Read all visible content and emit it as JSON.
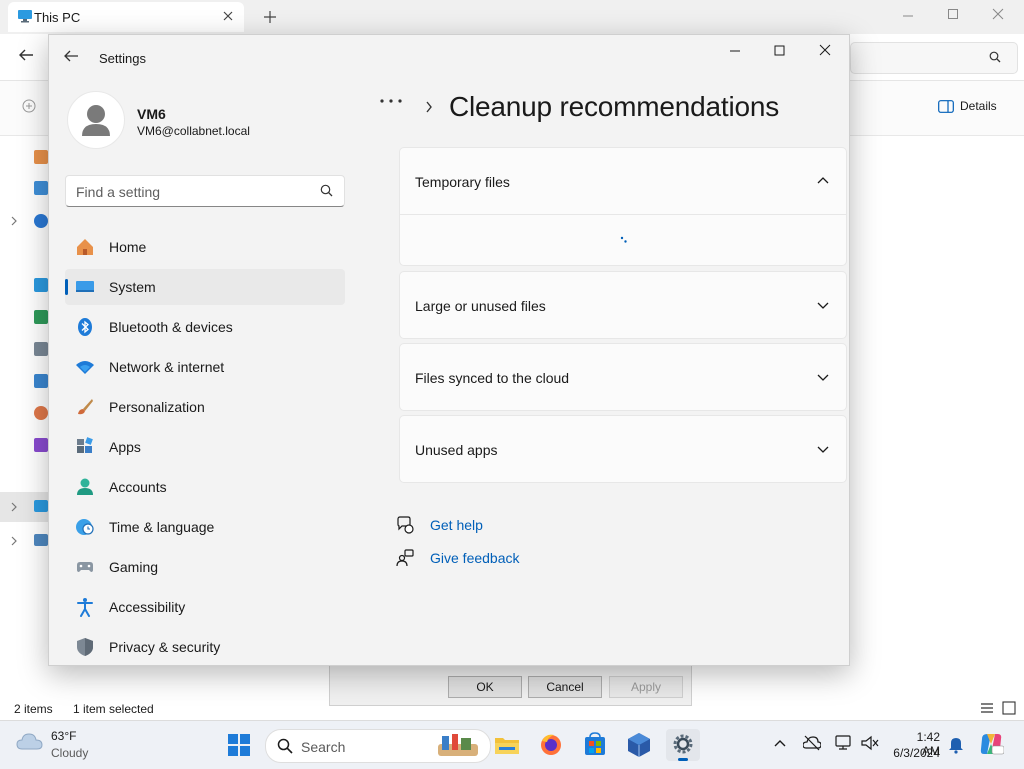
{
  "explorer": {
    "tab_title": "This PC",
    "details_label": "Details",
    "status_items": "2 items",
    "status_selected": "1 item selected",
    "dialog_buttons": {
      "ok": "OK",
      "cancel": "Cancel",
      "apply": "Apply"
    }
  },
  "settings": {
    "window_title": "Settings",
    "profile": {
      "name": "VM6",
      "email": "VM6@collabnet.local"
    },
    "search_placeholder": "Find a setting",
    "nav": [
      {
        "label": "Home",
        "icon": "home-icon"
      },
      {
        "label": "System",
        "icon": "system-icon",
        "selected": true
      },
      {
        "label": "Bluetooth & devices",
        "icon": "bluetooth-icon"
      },
      {
        "label": "Network & internet",
        "icon": "wifi-icon"
      },
      {
        "label": "Personalization",
        "icon": "brush-icon"
      },
      {
        "label": "Apps",
        "icon": "apps-icon"
      },
      {
        "label": "Accounts",
        "icon": "accounts-icon"
      },
      {
        "label": "Time & language",
        "icon": "globe-clock-icon"
      },
      {
        "label": "Gaming",
        "icon": "gamepad-icon"
      },
      {
        "label": "Accessibility",
        "icon": "accessibility-icon"
      },
      {
        "label": "Privacy & security",
        "icon": "shield-icon"
      }
    ],
    "breadcrumb_more": "•••",
    "page_title": "Cleanup recommendations",
    "cards": [
      {
        "label": "Temporary files",
        "expanded": true
      },
      {
        "label": "Large or unused files",
        "expanded": false
      },
      {
        "label": "Files synced to the cloud",
        "expanded": false
      },
      {
        "label": "Unused apps",
        "expanded": false
      }
    ],
    "links": {
      "help": "Get help",
      "feedback": "Give feedback"
    }
  },
  "taskbar": {
    "weather": {
      "temp": "63°F",
      "condition": "Cloudy"
    },
    "search_label": "Search",
    "clock": {
      "time": "1:42 AM",
      "date": "6/3/2024"
    }
  },
  "colors": {
    "accent": "#005fb8",
    "window_bg": "#f3f3f3",
    "card_bg": "#fbfbfb"
  }
}
